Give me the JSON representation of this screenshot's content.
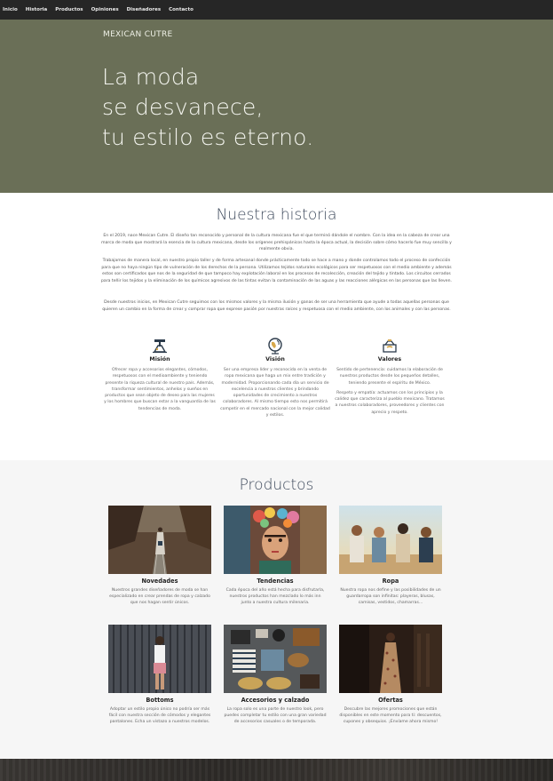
{
  "nav": {
    "items": [
      "Inicio",
      "Historia",
      "Productos",
      "Opiniones",
      "Diseñadores",
      "Contacto"
    ]
  },
  "hero": {
    "brand": "MEXICAN CUTRE",
    "lines": [
      "La moda",
      "se desvanece,",
      "tu estilo es eterno."
    ],
    "bg_color": "#6a6f57"
  },
  "history": {
    "title": "Nuestra historia",
    "paragraphs": [
      "En el 2019, nace Mexican Cutre. El diseño tan reconocido y personal de la cultura mexicana fue el que terminó dándole el nombre. Con la idea en la cabeza de crear una marca de moda que mostrará la esencia de la cultura mexicana, desde los orígenes prehispánicos hasta la época actual, la decisión sobre cómo hacerlo fue muy sencilla y realmente obvia.",
      "Trabajamos de manera local, en nuestro propio taller y de forma artesanal donde prácticamente todo se hace a mano y donde controlamos todo el proceso de confección para que no haya ningún tipo de vulneración de los derechos de la persona. Utilizamos tejidos naturales ecológicos para ser respetuosos con el medio ambiente y además estos son certificados que nos de la seguridad de que tampoco hay explotación laboral en los procesos de recolección, creación del tejido y tintado. Los circuitos cerrados para teñir los tejidos y la eliminación de los químicos agresivos de las tintas evitan la contaminación de las aguas y las reacciones alérgicas en las personas que las lleven.",
      "Desde nuestros inicios, en Mexican Cutre seguimos con los mismos valores y la misma ilusión y ganas de ser una herramienta que ayude a todas aquellas personas que quieren un cambio en la forma de crear y comprar ropa que exprese pasión por nuestras raíces y respetuosa con el medio ambiente, con los animales y con las personas."
    ],
    "features": [
      {
        "icon": "tailor-icon",
        "title": "Misión",
        "text": "Ofrecer ropa y accesorios elegantes, cómodos, respetuosos con el medioambiente y teniendo presente la riqueza cultural de nuestro país. Además, transformar sentimientos, anhelos y sueños en productos que sean objeto de deseo para las mujeres y los hombres que buscan estar a la vanguardia de las tendencias de moda.",
        "text2": ""
      },
      {
        "icon": "globe-icon",
        "title": "Visión",
        "text": "Ser una empresa líder y reconocida en la venta de ropa mexicana que haga un mix entre tradición y modernidad. Proporcionando cada día un servicio de excelencia a nuestros clientes y brindando oportunidades de crecimiento a nuestros colaboradores. Al mismo tiempo esto nos permitirá competir en el mercado nacional con la mejor calidad y estilos.",
        "text2": ""
      },
      {
        "icon": "handshake-icon",
        "title": "Valores",
        "text": "Sentido de pertenencia: cuidamos la elaboración de nuestros productos desde los pequeños detalles, teniendo presente el espíritu de México.",
        "text2": "Respeto y empatía: actuamos con los principios y la calidez que caracteriza al pueblo mexicano. Tratamos a nuestros colaboradores, proveedores y clientes con aprecio y respeto."
      }
    ]
  },
  "products": {
    "title": "Productos",
    "items": [
      {
        "title": "Novedades",
        "text": "Nuestros grandes diseñadores de moda se han especializado en crear prendas de ropa y calzado que nos hagan sentir únicos.",
        "image": "woman-with-poncho-on-railway-photo"
      },
      {
        "title": "Tendencias",
        "text": "Cada época del año está hecha para disfrutarla, nuestros productos han mezclado lo más inn junto a nuestra cultura milenaria.",
        "image": "frida-mural-photo"
      },
      {
        "title": "Ropa",
        "text": "Nuestra ropa nos define y las posibilidades de un guardarropa son infinitas: playeras, blusas, camisas, vestidos, chamarras...",
        "image": "friends-at-sunset-photo"
      },
      {
        "title": "Bottoms",
        "text": "Adoptar un estilo propio único no podría ser más fácil con nuestra sección de cómodos y elegantes pantalones. Echa un vistazo a nuestros modelos.",
        "image": "woman-against-metal-wall-photo"
      },
      {
        "title": "Accesorios y calzado",
        "text": "La ropa solo es una parte de nuestro look, pero puedes completar tu estilo con una gran variedad de accesorios casuales o de temporada.",
        "image": "flat-lay-accessories-photo"
      },
      {
        "title": "Ofertas",
        "text": "Descubre las mejores promociones que están disponibles en este momento para ti: descuentos, cupones y obsequios. ¡Envíame ahora mismo!",
        "image": "woman-in-floral-dress-photo"
      }
    ]
  }
}
